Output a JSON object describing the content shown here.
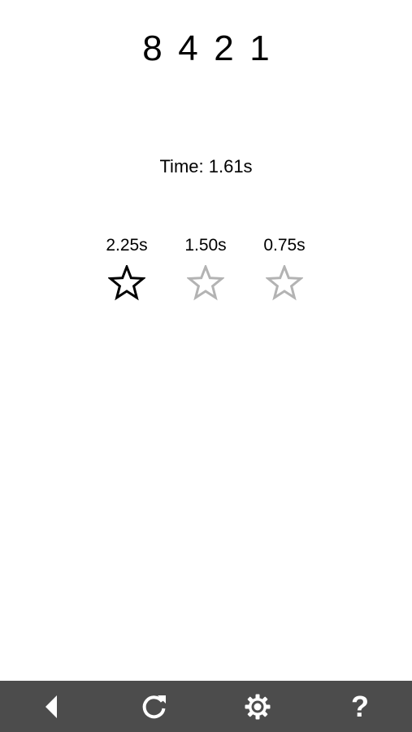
{
  "sequence": {
    "digits": [
      "8",
      "4",
      "2",
      "1"
    ]
  },
  "timer": {
    "label": "Time: 1.61s",
    "value_seconds": 1.61
  },
  "star_targets": [
    {
      "label": "2.25s",
      "threshold_seconds": 2.25,
      "earned": true
    },
    {
      "label": "1.50s",
      "threshold_seconds": 1.5,
      "earned": false
    },
    {
      "label": "0.75s",
      "threshold_seconds": 0.75,
      "earned": false
    }
  ],
  "stars_earned": 1,
  "stars_total": 3,
  "colors": {
    "background": "#ffffff",
    "text": "#000000",
    "star_earned": "#000000",
    "star_unearned": "#b3b3b3",
    "toolbar_bg": "#4c4c4c",
    "toolbar_icon": "#ffffff"
  },
  "toolbar": {
    "buttons": [
      {
        "icon": "back-arrow-icon"
      },
      {
        "icon": "restart-icon"
      },
      {
        "icon": "gear-icon"
      },
      {
        "icon": "help-icon",
        "glyph": "?"
      }
    ]
  }
}
